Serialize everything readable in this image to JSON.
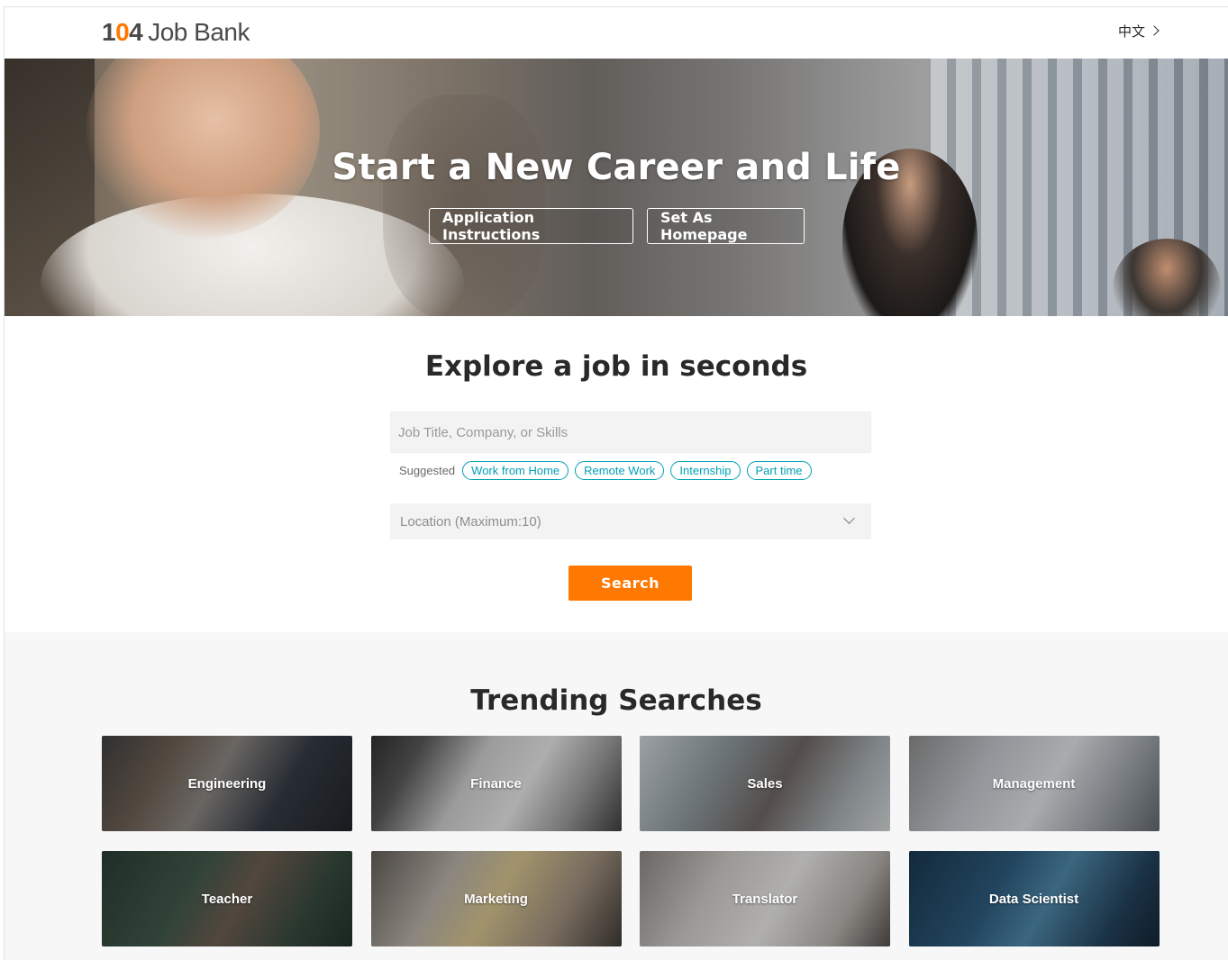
{
  "header": {
    "logo_1": "1",
    "logo_0": "0",
    "logo_4": "4",
    "logo_word": "Job Bank",
    "language_label": "中文"
  },
  "hero": {
    "title": "Start a New Career and Life",
    "buttons": [
      {
        "label": "Application Instructions"
      },
      {
        "label": "Set As Homepage"
      }
    ]
  },
  "search": {
    "title": "Explore a job in seconds",
    "keyword_placeholder": "Job Title, Company, or Skills",
    "keyword_value": "",
    "suggested_label": "Suggested",
    "suggested_tags": [
      "Work from Home",
      "Remote Work",
      "Internship",
      "Part time"
    ],
    "location_placeholder": "Location (Maximum:10)",
    "search_button": "Search"
  },
  "trending": {
    "title": "Trending Searches",
    "items": [
      "Engineering",
      "Finance",
      "Sales",
      "Management",
      "Teacher",
      "Marketing",
      "Translator",
      "Data Scientist"
    ]
  },
  "colors": {
    "brand_orange": "#ff7800",
    "tag_teal": "#00a1b5",
    "text_dark": "#292929"
  }
}
